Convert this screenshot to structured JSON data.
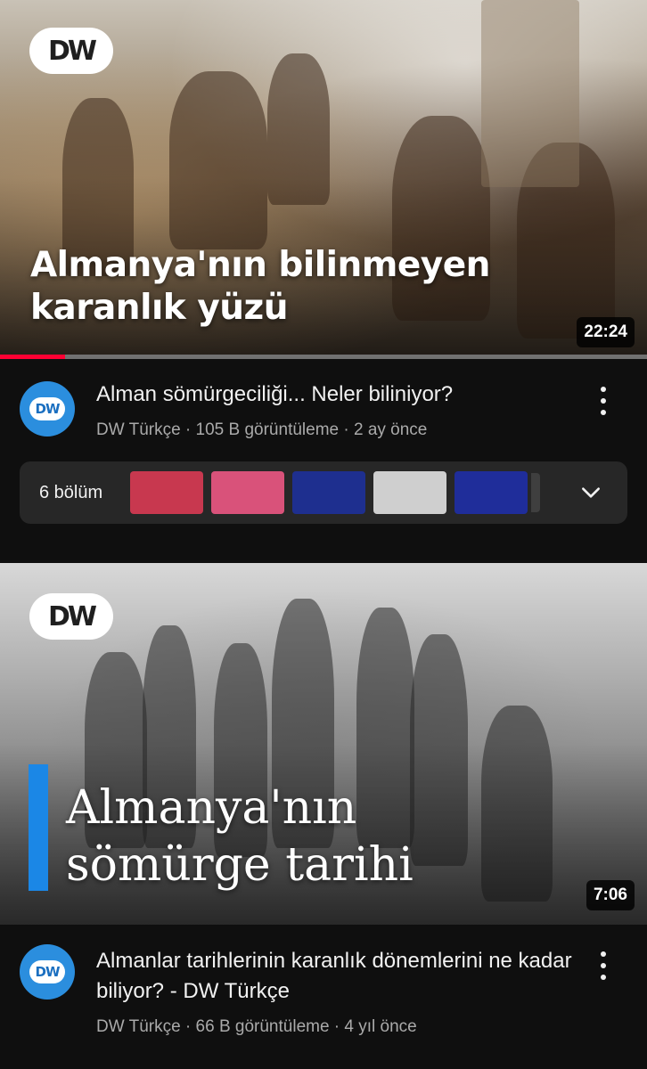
{
  "videos": [
    {
      "thumbnail_title_line1": "Almanya'nın bilinmeyen",
      "thumbnail_title_line2": "karanlık yüzü",
      "logo_text": "DW",
      "duration": "22:24",
      "watched_fraction": 0.1,
      "title": "Alman sömürgeciliği... Neler biliniyor?",
      "channel": "DW Türkçe",
      "views": "105 B görüntüleme",
      "age": "2 ay önce",
      "meta": "DW Türkçe · 105 B görüntüleme · 2 ay önce",
      "avatar_text": "DW",
      "chapters": {
        "label": "6 bölüm",
        "thumb_colors": [
          "#c8384f",
          "#d9527a",
          "#1e2f8f",
          "#cfcfcf",
          "#1f2d9a"
        ]
      }
    },
    {
      "thumbnail_title_line1": "Almanya'nın",
      "thumbnail_title_line2": "sömürge tarihi",
      "logo_text": "DW",
      "duration": "7:06",
      "title": "Almanlar tarihlerinin karanlık dönemlerini ne kadar biliyor? - DW Türkçe",
      "meta": "DW Türkçe · 66 B görüntüleme · 4 yıl önce",
      "avatar_text": "DW"
    }
  ],
  "colors": {
    "background": "#0f0f0f",
    "progress": "#ff0033",
    "accent_blue": "#1b87e6"
  }
}
